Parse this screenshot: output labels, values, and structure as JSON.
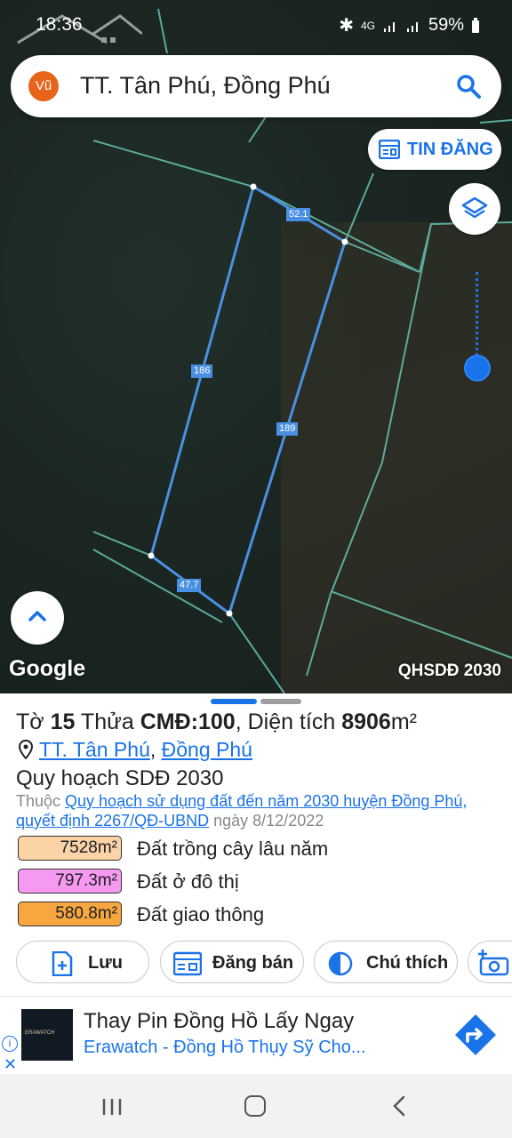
{
  "status_bar": {
    "time": "18:36",
    "icons": [
      "bluetooth-icon",
      "4g-icon",
      "signal-icon",
      "signal-icon"
    ],
    "battery": "59%"
  },
  "search_bar": {
    "avatar": "Vũ",
    "title": "TT. Tân Phú, Đồng Phú"
  },
  "map": {
    "tin_dang_label": "TIN ĐĂNG",
    "edge_labels": [
      "52.1",
      "186",
      "189",
      "47.7"
    ],
    "google_label": "Google",
    "plan_label": "QHSDĐ 2030",
    "accent": "#1a73e8"
  },
  "parcel": {
    "title_prefix": "Tờ ",
    "sheet": "15",
    "title_mid": " Thửa ",
    "plot": "CMĐ:100",
    "title_area_label": ", Diện tích ",
    "area": "8906",
    "area_unit": "m²",
    "location_town": "TT. Tân Phú",
    "location_sep": ",",
    "location_district": "Đồng Phú",
    "plan_title": "Quy hoạch SDĐ 2030",
    "belongs_prefix": "Thuộc ",
    "belongs_link": "Quy hoạch sử dụng đất đến năm 2030 huyện Đồng Phú, quyết định 2267/QĐ-UBND",
    "belongs_suffix": " ngày 8/12/2022"
  },
  "legend": [
    {
      "area": "7528m²",
      "label": "Đất trồng cây lâu năm",
      "color": "#fbd3a6"
    },
    {
      "area": "797.3m²",
      "label": "Đất ở đô thị",
      "color": "#f59af0"
    },
    {
      "area": "580.8m²",
      "label": "Đất giao thông",
      "color": "#f7a640"
    }
  ],
  "actions": {
    "save": "Lưu",
    "post_sale": "Đăng bán",
    "legend": "Chú thích"
  },
  "ad": {
    "brand": "ERAWATCH",
    "title": "Thay Pin Đồng Hồ Lấy Ngay",
    "subtitle": "Erawatch - Đồng Hồ Thụy Sỹ Cho...",
    "info": "i",
    "close": "✕"
  }
}
